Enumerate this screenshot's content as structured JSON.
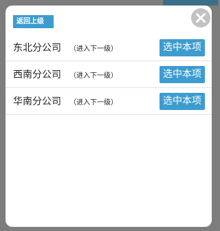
{
  "header": {
    "back_label": "返回上级"
  },
  "items": [
    {
      "name": "东北分公司",
      "enter_label": "（进入下一级）",
      "select_label": "选中本项"
    },
    {
      "name": "西南分公司",
      "enter_label": "（进入下一级）",
      "select_label": "选中本项"
    },
    {
      "name": "华南分公司",
      "enter_label": "（进入下一级）",
      "select_label": "选中本项"
    }
  ],
  "colors": {
    "accent": "#3d9ccf",
    "close_bg": "#c2c2c2",
    "overlay": "#7d7d7d"
  },
  "icons": {
    "close": "close-icon"
  }
}
